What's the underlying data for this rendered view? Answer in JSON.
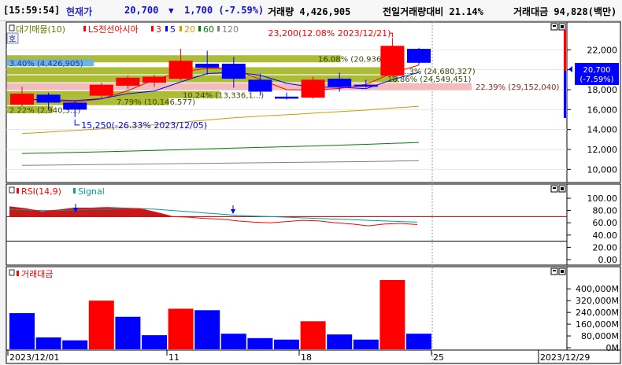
{
  "header": {
    "time": "[15:59:54]",
    "current_label": "현재가",
    "current_price": "20,700",
    "change_arrow": "▼",
    "change": "1,700 (-7.59%)",
    "volume": "거래량 4,426,905",
    "volume_ratio": "전일거래량대비 21.14%",
    "amount": "거래대금 94,828(백만)"
  },
  "legend": {
    "price_pane": [
      "대기매물(10)",
      "LS전선아시아",
      "3",
      "5",
      "20",
      "60",
      "120"
    ],
    "rsi_pane": [
      "RSI(14,9)",
      "Signal"
    ],
    "amount_pane": [
      "거래대금"
    ]
  },
  "hoga_badge": "호",
  "price_axis": {
    "ticks": [
      "22,000",
      "20,000",
      "18,000",
      "16,000",
      "14,000",
      "12,000",
      "10,000"
    ],
    "current_box": [
      "20,700",
      "(-7.59%)"
    ]
  },
  "rsi_axis": {
    "ticks": [
      "100.00",
      "80.00",
      "60.00",
      "40.00",
      "20.00",
      "0.00"
    ]
  },
  "amount_axis": {
    "ticks": [
      "400,000M",
      "320,000M",
      "240,000M",
      "160,000M",
      "80,000M",
      "0M"
    ]
  },
  "date_axis": {
    "ticks": [
      "2023/12/01",
      "11",
      "18",
      "25",
      "2023/12/29"
    ]
  },
  "annotations": {
    "high": "23,200(12.08% 2023/12/21)",
    "low": "15,250(-26.33% 2023/12/05)",
    "profile_labels": [
      "16.08% (20,936,...)",
      "3.40% (4,426,905)",
      "...3% (24,680,327)",
      "18.86% (24,549,451)",
      "22.39% (29,152,040)",
      "10.24% (13,336,1...)",
      "7.79% (10,146,577)",
      "2.22% (2,940,3...)"
    ]
  },
  "colors": {
    "up": "#ff0000",
    "down": "#0000ff",
    "ma3": "#ff0000",
    "ma5": "#0000ff",
    "ma20": "#c8a000",
    "ma60": "#008000",
    "ma120": "#808080",
    "rsi": "#ff0000",
    "signal": "#00a0a0",
    "profile": "#a8b82c",
    "profile_max": "#f2b8b8",
    "profile_cur": "#6bb0e6"
  },
  "chart_data": [
    {
      "type": "candlestick",
      "title": "LS전선아시아",
      "x": [
        "2023/12/01",
        "2023/12/04",
        "2023/12/05",
        "2023/12/06",
        "2023/12/07",
        "2023/12/08",
        "2023/12/11",
        "2023/12/12",
        "2023/12/13",
        "2023/12/14",
        "2023/12/15",
        "2023/12/18",
        "2023/12/19",
        "2023/12/20",
        "2023/12/21",
        "2023/12/22"
      ],
      "ohlc": [
        [
          16500,
          18300,
          16300,
          17600
        ],
        [
          17500,
          17700,
          16000,
          16700
        ],
        [
          16700,
          16900,
          15250,
          16000
        ],
        [
          17400,
          18700,
          17200,
          18500
        ],
        [
          18400,
          19400,
          18100,
          19200
        ],
        [
          18700,
          19500,
          18300,
          19300
        ],
        [
          19100,
          22100,
          18900,
          20900
        ],
        [
          20600,
          21900,
          19500,
          20200
        ],
        [
          20600,
          21300,
          18200,
          19100
        ],
        [
          19000,
          19600,
          17400,
          17800
        ],
        [
          17300,
          17700,
          17000,
          17100
        ],
        [
          17200,
          19300,
          17100,
          19000
        ],
        [
          19100,
          19700,
          17800,
          18300
        ],
        [
          18500,
          19000,
          18200,
          18300
        ],
        [
          19400,
          23200,
          19300,
          22400
        ],
        [
          22100,
          22200,
          20500,
          20700
        ]
      ],
      "moving_averages": [
        {
          "name": "3",
          "values": [
            17100,
            16900,
            16770,
            17070,
            17900,
            19000,
            19800,
            20130,
            20070,
            19030,
            18000,
            17970,
            18130,
            18530,
            19670,
            20470
          ]
        },
        {
          "name": "5",
          "values": [
            17000,
            17000,
            16900,
            17100,
            17600,
            17860,
            18780,
            19620,
            19740,
            19460,
            18640,
            18240,
            18260,
            18100,
            19000,
            19740
          ]
        },
        {
          "name": "20",
          "values": [
            13600,
            13750,
            13900,
            14080,
            14280,
            14480,
            14720,
            14960,
            15180,
            15350,
            15480,
            15640,
            15800,
            15950,
            16160,
            16330
          ]
        },
        {
          "name": "60",
          "values": [
            11600,
            11650,
            11700,
            11760,
            11830,
            11900,
            11980,
            12060,
            12140,
            12210,
            12280,
            12350,
            12430,
            12510,
            12610,
            12700
          ]
        },
        {
          "name": "120",
          "values": [
            10400,
            10430,
            10460,
            10490,
            10520,
            10550,
            10580,
            10610,
            10640,
            10670,
            10700,
            10730,
            10760,
            10790,
            10830,
            10870
          ]
        }
      ],
      "volume_profile": [
        {
          "price": 21100,
          "pct": 16.08,
          "volume": "20,93..."
        },
        {
          "price": 20700,
          "pct": 3.4,
          "volume": "4,426,905"
        },
        {
          "price": 19900,
          "pct": 19.0,
          "volume": "24,680,327"
        },
        {
          "price": 19100,
          "pct": 18.86,
          "volume": "24,549,451"
        },
        {
          "price": 18300,
          "pct": 22.39,
          "volume": "29,152,040"
        },
        {
          "price": 17500,
          "pct": 10.24,
          "volume": "13,336,1..."
        },
        {
          "price": 16800,
          "pct": 7.79,
          "volume": "10,146,577"
        },
        {
          "price": 16000,
          "pct": 2.22,
          "volume": "2,940,3..."
        }
      ],
      "ylim": [
        9000,
        24000
      ]
    },
    {
      "type": "line",
      "title": "RSI(14,9)",
      "series": [
        {
          "name": "RSI(14,9)",
          "values": [
            86,
            83,
            78,
            81,
            84,
            84,
            85,
            84,
            83,
            77,
            70,
            69,
            67,
            66,
            63,
            61,
            60,
            62,
            64,
            63,
            60,
            58,
            55,
            58,
            59,
            57
          ]
        },
        {
          "name": "Signal",
          "values": [
            82,
            81,
            80,
            80,
            81,
            82,
            82,
            83,
            83,
            82,
            80,
            78,
            76,
            74,
            72,
            71,
            70,
            69,
            68,
            67,
            66,
            65,
            64,
            63,
            62,
            61
          ]
        }
      ],
      "reference_lines": [
        70,
        30
      ],
      "ylim": [
        0,
        100
      ]
    },
    {
      "type": "bar",
      "title": "거래대금",
      "x": [
        "2023/12/01",
        "2023/12/04",
        "2023/12/05",
        "2023/12/06",
        "2023/12/07",
        "2023/12/08",
        "2023/12/11",
        "2023/12/12",
        "2023/12/13",
        "2023/12/14",
        "2023/12/15",
        "2023/12/18",
        "2023/12/19",
        "2023/12/20",
        "2023/12/21",
        "2023/12/22"
      ],
      "values": [
        235000,
        70000,
        50000,
        320000,
        210000,
        85000,
        265000,
        255000,
        95000,
        65000,
        55000,
        180000,
        90000,
        55000,
        460000,
        95000
      ],
      "direction": [
        "down",
        "down",
        "down",
        "up",
        "down",
        "down",
        "up",
        "down",
        "down",
        "down",
        "down",
        "up",
        "down",
        "down",
        "up",
        "down"
      ],
      "ylim": [
        0,
        460000
      ]
    }
  ]
}
